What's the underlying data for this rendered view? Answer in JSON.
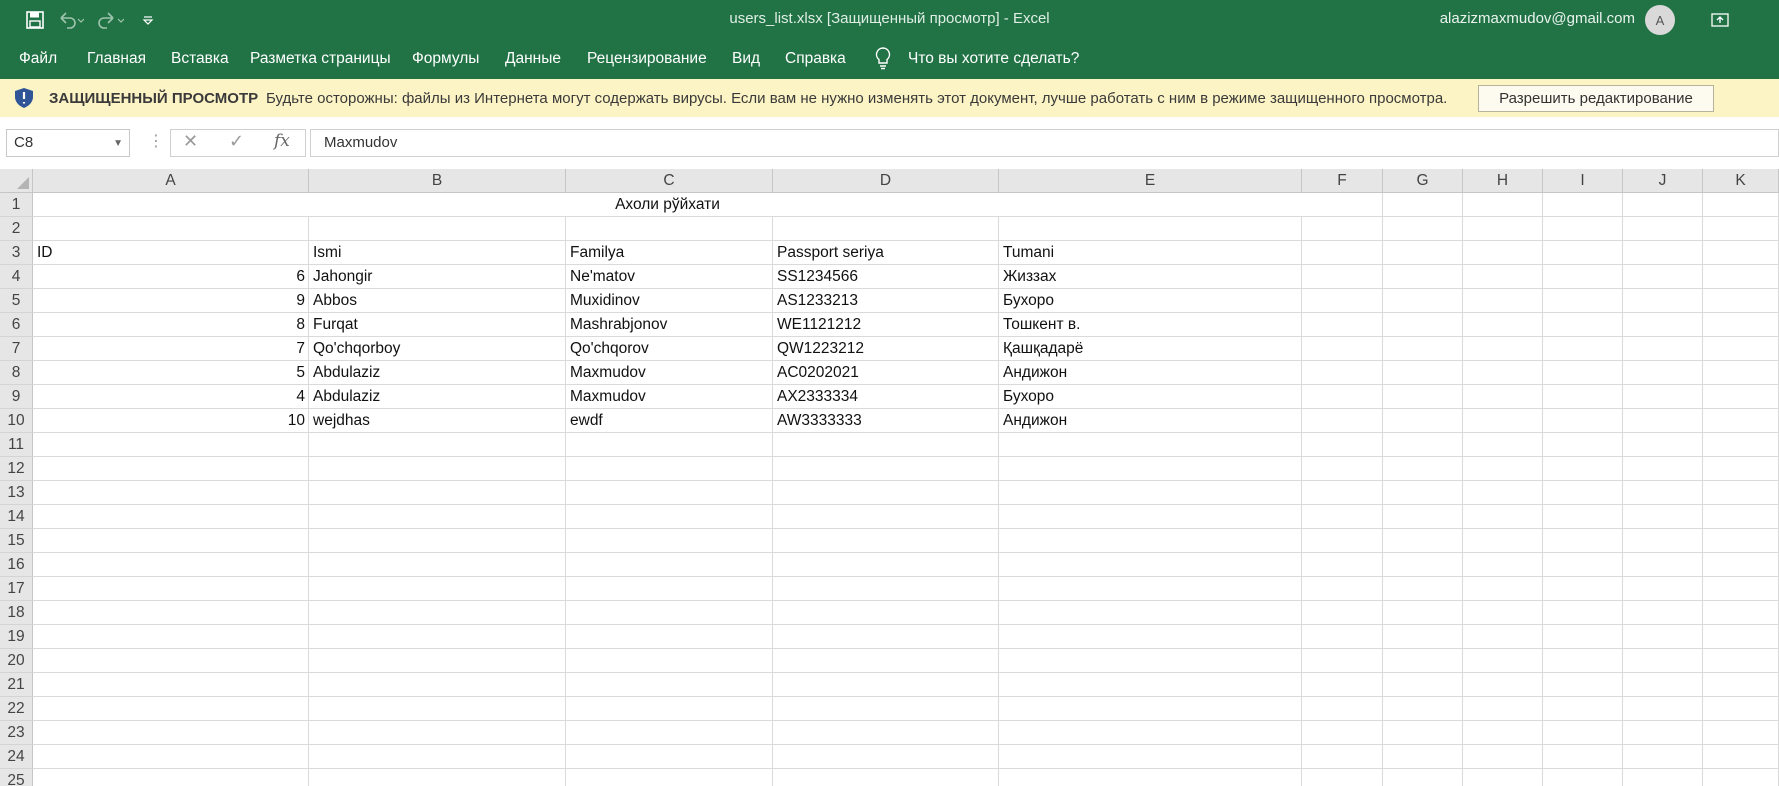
{
  "window": {
    "title": "users_list.xlsx  [Защищенный просмотр]  -  Excel",
    "account": "alazizmaxmudov@gmail.com",
    "avatar_initial": "A",
    "icons": [
      "save-icon",
      "undo-icon",
      "redo-icon",
      "customize-qat-icon",
      "ribbon-display-icon"
    ]
  },
  "menu": {
    "items": [
      "Файл",
      "Главная",
      "Вставка",
      "Разметка страницы",
      "Формулы",
      "Данные",
      "Рецензирование",
      "Вид",
      "Справка"
    ],
    "tell_me": "Что вы хотите сделать?"
  },
  "protected_view": {
    "title": "ЗАЩИЩЕННЫЙ ПРОСМОТР",
    "message": "Будьте осторожны: файлы из Интернета могут содержать вирусы. Если вам не нужно изменять этот документ, лучше работать с ним в режиме защищенного просмотра.",
    "button": "Разрешить редактирование"
  },
  "formula_bar": {
    "name_box": "C8",
    "content": "Maxmudov",
    "fx": "fx"
  },
  "sheet": {
    "columns": [
      "A",
      "B",
      "C",
      "D",
      "E",
      "F",
      "G",
      "H",
      "I",
      "J",
      "K"
    ],
    "rows": [
      "1",
      "2",
      "3",
      "4",
      "5",
      "6",
      "7",
      "8",
      "9",
      "10",
      "11",
      "12",
      "13",
      "14",
      "15",
      "16",
      "17",
      "18",
      "19",
      "20",
      "21",
      "22",
      "23",
      "24",
      "25"
    ],
    "title": "Ахоли рўйхати",
    "headers": [
      "ID",
      "Ismi",
      "Familya",
      "Passport seriya",
      "Tumani"
    ],
    "data": [
      [
        "6",
        "Jahongir",
        "Ne'matov",
        "SS1234566",
        "Жиззах"
      ],
      [
        "9",
        "Abbos",
        "Muxidinov",
        "AS1233213",
        "Бухоро"
      ],
      [
        "8",
        "Furqat",
        "Mashrabjonov",
        "WE1121212",
        "Тошкент в."
      ],
      [
        "7",
        "Qo'chqorboy",
        "Qo'chqorov",
        "QW1223212",
        "Қашқадарё"
      ],
      [
        "5",
        "Abdulaziz",
        "Maxmudov",
        "AC0202021",
        "Андижон"
      ],
      [
        "4",
        "Abdulaziz",
        "Maxmudov",
        "AX2333334",
        "Бухоро"
      ],
      [
        "10",
        "wejdhas",
        "ewdf",
        "AW3333333",
        "Андижон"
      ]
    ]
  },
  "colors": {
    "excel_green": "#217346",
    "protected_bar": "#fcf4c5"
  }
}
